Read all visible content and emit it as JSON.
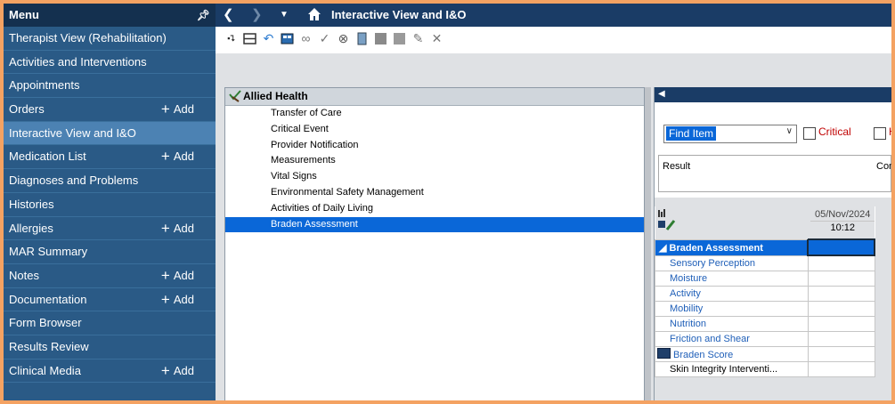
{
  "sidebar": {
    "title": "Menu",
    "items": [
      {
        "label": "Therapist View (Rehabilitation)",
        "add": ""
      },
      {
        "label": "Activities and Interventions",
        "add": ""
      },
      {
        "label": "Appointments",
        "add": ""
      },
      {
        "label": "Orders",
        "add": "Add"
      },
      {
        "label": "Interactive View and I&O",
        "add": ""
      },
      {
        "label": "Medication List",
        "add": "Add"
      },
      {
        "label": "Diagnoses and Problems",
        "add": ""
      },
      {
        "label": "Histories",
        "add": ""
      },
      {
        "label": "Allergies",
        "add": "Add"
      },
      {
        "label": "MAR Summary",
        "add": ""
      },
      {
        "label": "Notes",
        "add": "Add"
      },
      {
        "label": "Documentation",
        "add": "Add"
      },
      {
        "label": "Form Browser",
        "add": ""
      },
      {
        "label": "Results Review",
        "add": ""
      },
      {
        "label": "Clinical Media",
        "add": "Add"
      }
    ]
  },
  "header": {
    "title": "Interactive View and I&O"
  },
  "band": {
    "title": "Allied Health",
    "items": [
      "Transfer of Care",
      "Critical Event",
      "Provider Notification",
      "Measurements",
      "Vital Signs",
      "Environmental Safety Management",
      "Activities of Daily Living",
      "Braden Assessment"
    ],
    "selected_index": 7
  },
  "find": {
    "value": "Find Item",
    "critical_label": "Critical",
    "high_label": "Hi"
  },
  "result": {
    "result_label": "Result",
    "comment_label": "Con"
  },
  "flowsheet": {
    "date": "05/Nov/2024",
    "time": "10:12",
    "section": "Braden Assessment",
    "rows": [
      "Sensory Perception",
      "Moisture",
      "Activity",
      "Mobility",
      "Nutrition",
      "Friction and Shear",
      "Braden Score",
      "Skin Integrity Interventi..."
    ]
  },
  "colors": {
    "sidebar_bg": "#2a5a86",
    "sidebar_active": "#4c82b3",
    "titlebar_bg": "#1a3c66",
    "selection_blue": "#0a67d8",
    "frame_border": "#f4a262"
  }
}
